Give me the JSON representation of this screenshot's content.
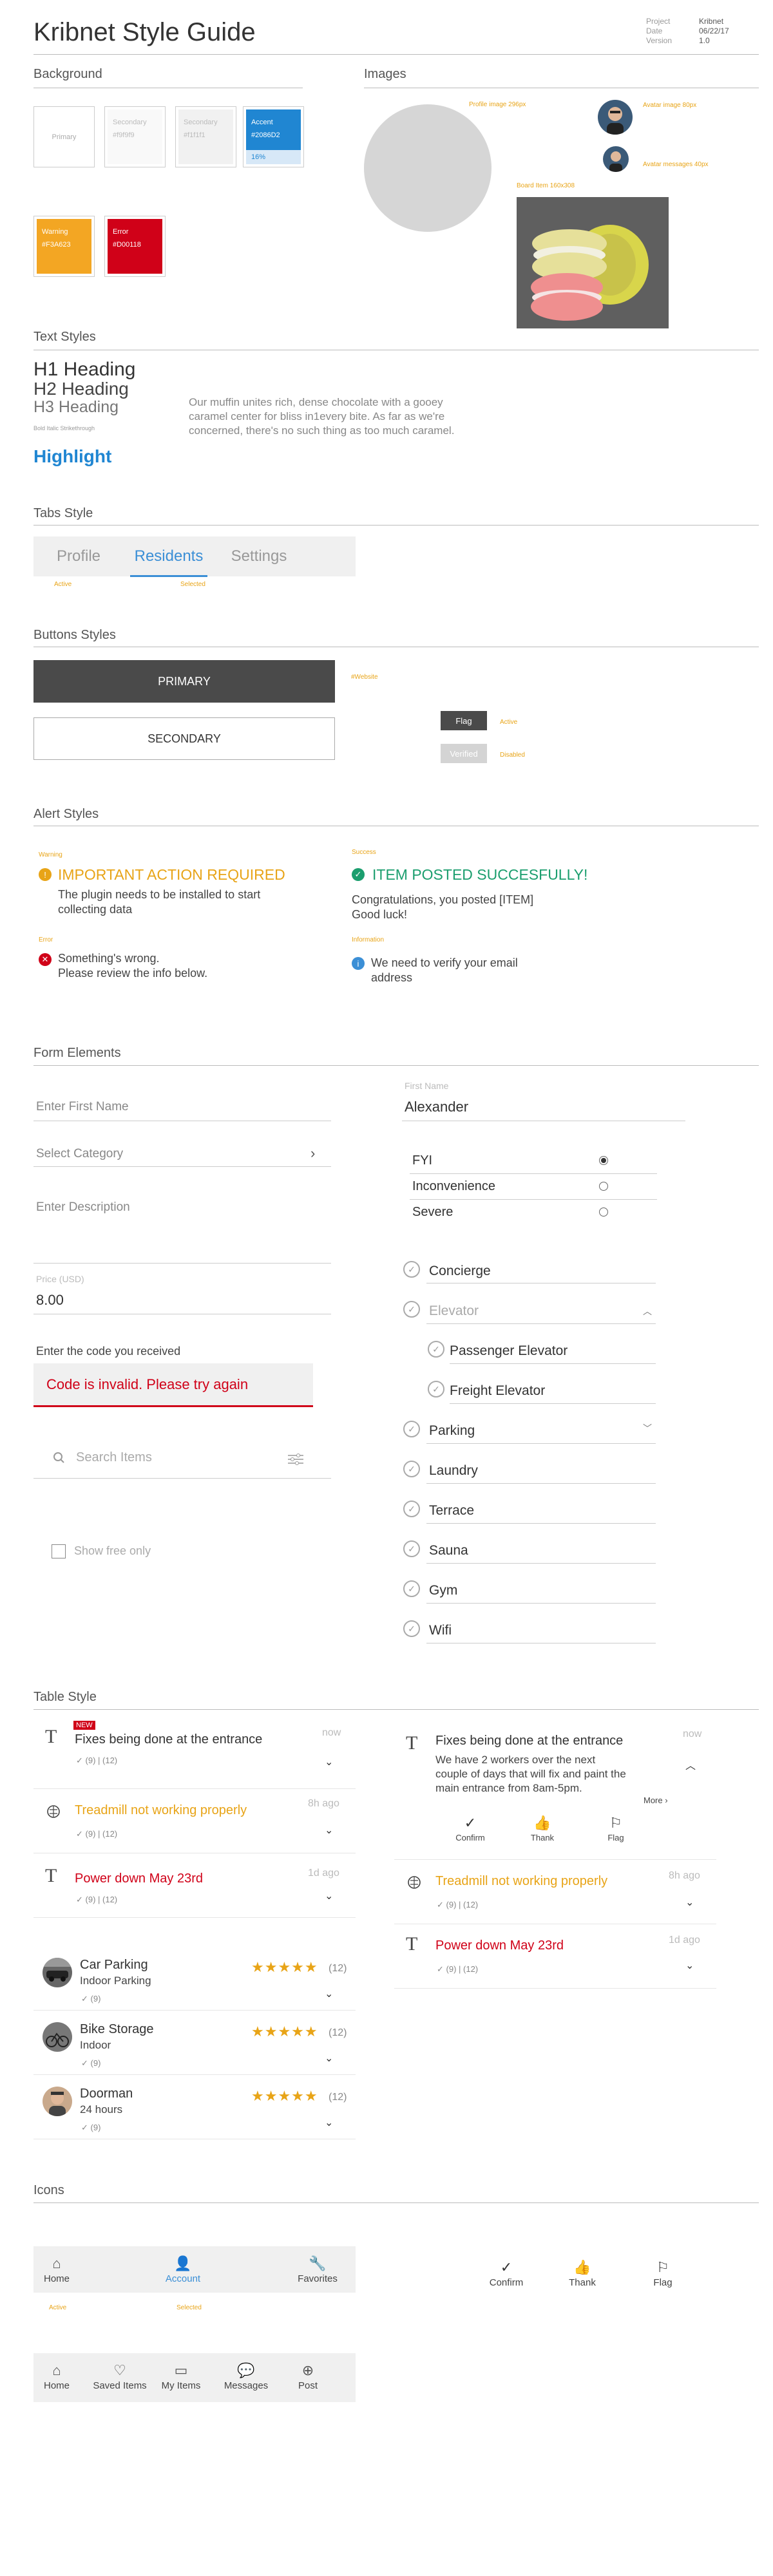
{
  "header": {
    "title": "Kribnet Style Guide",
    "meta": [
      {
        "key": "Project",
        "value": "Kribnet"
      },
      {
        "key": "Date",
        "value": "06/22/17"
      },
      {
        "key": "Version",
        "value": "1.0"
      }
    ]
  },
  "background": {
    "title": "Background",
    "swatches": [
      {
        "name": "Primary",
        "hex": "",
        "bg": "#ffffff",
        "fg": "#aaaaaa"
      },
      {
        "name": "Secondary",
        "hex": "#f9f9f9",
        "bg": "#f9f9f9",
        "fg": "#bbbbbb"
      },
      {
        "name": "Secondary",
        "hex": "#f1f1f1",
        "bg": "#f1f1f1",
        "fg": "#bbbbbb"
      },
      {
        "name": "Accent",
        "hex": "#2086D2",
        "tint": "16%",
        "bg": "#2086d2",
        "fg": "#ffffff"
      },
      {
        "name": "Warning",
        "hex": "#F3A623",
        "bg": "#f3a623",
        "fg": "#ffffff"
      },
      {
        "name": "Error",
        "hex": "#D00118",
        "bg": "#d00118",
        "fg": "#ffffff"
      }
    ]
  },
  "images": {
    "title": "Images",
    "profile_note": "Profile image 296px",
    "avatar_note": "Avatar image 80px",
    "avatar_msg_note": "Avatar messages 40px",
    "board_note": "Board Item 160x308"
  },
  "text_styles": {
    "title": "Text Styles",
    "h1": "H1 Heading",
    "h2": "H2 Heading",
    "h3": "H3 Heading",
    "small": "Bold Italic Strikethrough",
    "highlight": "Highlight",
    "paragraph": "Our muffin unites rich, dense chocolate with a gooey caramel center for bliss in1every bite. As far as we're concerned, there's no such thing as too much caramel."
  },
  "tabs_style": {
    "title": "Tabs Style",
    "tabs": [
      "Profile",
      "Residents",
      "Settings"
    ],
    "active_note": "Active",
    "selected_note": "Selected"
  },
  "buttons": {
    "title": "Buttons Styles",
    "primary": "PRIMARY",
    "secondary": "SECONDARY",
    "states_note": "#Website",
    "flag": "Flag",
    "flag_state": "Active",
    "verified": "Verified",
    "verified_state": "Disabled"
  },
  "alerts": {
    "title": "Alert Styles",
    "warning": {
      "label": "Warning",
      "head": "IMPORTANT ACTION REQUIRED",
      "body": "The plugin needs to be installed to start collecting data",
      "color": "#e8a417"
    },
    "success": {
      "label": "Success",
      "head": "ITEM POSTED SUCCESFULLY!",
      "body": "Congratulations, you posted [ITEM] Good luck!",
      "color": "#1b9e6e"
    },
    "error": {
      "label": "Error",
      "head": "Something's wrong.",
      "body": "Please review the info below.",
      "color": "#d00118"
    },
    "info": {
      "label": "Information",
      "body": "We need to verify your email address",
      "color": "#3b8fd6"
    }
  },
  "form": {
    "title": "Form Elements",
    "first_name_placeholder": "Enter First Name",
    "first_name_label": "First Name",
    "first_name_value": "Alexander",
    "category_placeholder": "Select Category",
    "description_placeholder": "Enter Description",
    "price_label": "Price (USD)",
    "price_value": "8.00",
    "code_label": "Enter the code you received",
    "code_error": "Code is invalid. Please try again",
    "search_placeholder": "Search Items",
    "free_only": "Show free only",
    "radios": [
      {
        "label": "FYI",
        "selected": true
      },
      {
        "label": "Inconvenience",
        "selected": false
      },
      {
        "label": "Severe",
        "selected": false
      }
    ],
    "checks": {
      "concierge": "Concierge",
      "elevator": "Elevator",
      "passenger": "Passenger Elevator",
      "freight": "Freight Elevator",
      "parking": "Parking",
      "laundry": "Laundry",
      "terrace": "Terrace",
      "sauna": "Sauna",
      "gym": "Gym",
      "wifi": "Wifi"
    }
  },
  "table": {
    "title": "Table Style",
    "new_badge": "NEW",
    "left": [
      {
        "title": "Fixes being done at the entrance",
        "time": "now",
        "meta": "(9) | (12)",
        "color": "#333333"
      },
      {
        "title": "Treadmill not working properly",
        "time": "8h ago",
        "meta": "(9) | (12)",
        "color": "#e8a417"
      },
      {
        "title": "Power down May 23rd",
        "time": "1d ago",
        "meta": "(9) | (12)",
        "color": "#d00118"
      }
    ],
    "right": [
      {
        "title": "Fixes being done at the entrance",
        "time": "now",
        "body": "We have 2 workers over the next couple of days that will fix and paint the main entrance from 8am-5pm.",
        "more": "More ›",
        "color": "#333333"
      },
      {
        "title": "Treadmill not working properly",
        "time": "8h ago",
        "meta": "(9) | (12)",
        "color": "#e8a417"
      },
      {
        "title": "Power down May 23rd",
        "time": "1d ago",
        "meta": "(9) | (12)",
        "color": "#d00118"
      }
    ],
    "actions": [
      "Confirm",
      "Thank",
      "Flag"
    ],
    "people": [
      {
        "name": "Car Parking",
        "sub": "Indoor Parking",
        "rating": 5,
        "count": "(12)",
        "meta": "(9)"
      },
      {
        "name": "Bike Storage",
        "sub": "Indoor",
        "rating": 5,
        "count": "(12)",
        "meta": "(9)"
      },
      {
        "name": "Doorman",
        "sub": "24 hours",
        "rating": 5,
        "count": "(12)",
        "meta": "(9)"
      }
    ]
  },
  "icons": {
    "title": "Icons",
    "nav1": [
      "Home",
      "Account",
      "Favorites"
    ],
    "active_note": "Active",
    "selected_note": "Selected",
    "actions": [
      "Confirm",
      "Thank",
      "Flag"
    ],
    "nav2": [
      "Home",
      "Saved Items",
      "My Items",
      "Messages",
      "Post"
    ]
  }
}
